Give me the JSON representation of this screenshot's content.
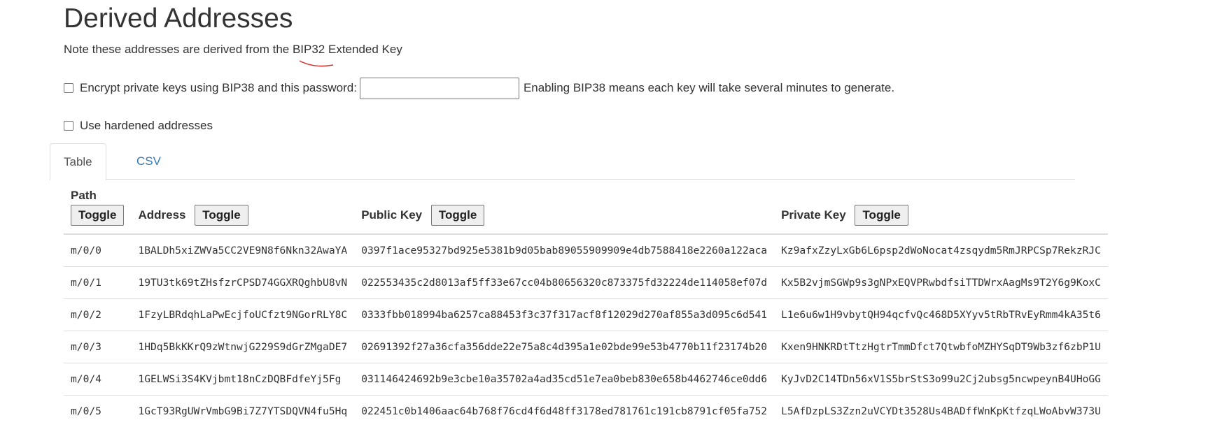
{
  "heading": "Derived Addresses",
  "note": {
    "prefix": "Note these addresses are derived from the ",
    "link_text": "BIP32 Extended Key"
  },
  "bip38": {
    "label": "Encrypt private keys using BIP38 and this password:",
    "password_value": "",
    "hint": "Enabling BIP38 means each key will take several minutes to generate."
  },
  "hardened": {
    "label": "Use hardened addresses"
  },
  "tabs": [
    {
      "label": "Table",
      "active": true
    },
    {
      "label": "CSV",
      "active": false
    }
  ],
  "table": {
    "headers": {
      "path": "Path",
      "address": "Address",
      "public_key": "Public Key",
      "private_key": "Private Key",
      "toggle": "Toggle"
    },
    "rows": [
      {
        "path": "m/0/0",
        "address": "1BALDh5xiZWVa5CC2VE9N8f6Nkn32AwaYA",
        "public_key": "0397f1ace95327bd925e5381b9d05bab89055909909e4db7588418e2260a122aca",
        "private_key": "Kz9afxZzyLxGb6L6psp2dWoNocat4zsqydm5RmJRPCSp7RekzRJC"
      },
      {
        "path": "m/0/1",
        "address": "19TU3tk69tZHsfzrCPSD74GGXRQghbU8vN",
        "public_key": "022553435c2d8013af5ff33e67cc04b80656320c873375fd32224de114058ef07d",
        "private_key": "Kx5B2vjmSGWp9s3gNPxEQVPRwbdfsiTTDWrxAagMs9T2Y6g9KoxC"
      },
      {
        "path": "m/0/2",
        "address": "1FzyLBRdqhLaPwEcjfoUCfzt9NGorRLY8C",
        "public_key": "0333fbb018994ba6257ca88453f3c37f317acf8f12029d270af855a3d095c6d541",
        "private_key": "L1e6u6w1H9vbytQH94qcfvQc468D5XYyv5tRbTRvEyRmm4kA35t6"
      },
      {
        "path": "m/0/3",
        "address": "1HDq5BkKKrQ9zWtnwjG229S9dGrZMgaDE7",
        "public_key": "02691392f27a36cfa356dde22e75a8c4d395a1e02bde99e53b4770b11f23174b20",
        "private_key": "Kxen9HNKRDtTtzHgtrTmmDfct7QtwbfoMZHYSqDT9Wb3zf6zbP1U"
      },
      {
        "path": "m/0/4",
        "address": "1GELWSi3S4KVjbmt18nCzDQBFdfeYj5Fg",
        "public_key": "031146424692b9e3cbe10a35702a4ad35cd51e7ea0beb830e658b4462746ce0dd6",
        "private_key": "KyJvD2C14TDn56xV1S5brStS3o99u2Cj2ubsg5ncwpeynB4UHoGG"
      },
      {
        "path": "m/0/5",
        "address": "1GcT93RgUWrVmbG9Bi7Z7YTSDQVN4fu5Hq",
        "public_key": "022451c0b1406aac64b768f76cd4f6d48ff3178ed781761c191cb8791cf05fa752",
        "private_key": "L5AfDzpLS3Zzn2uVCYDt3528Us4BADffWnKpKtfzqLWoAbvW373U"
      }
    ]
  }
}
